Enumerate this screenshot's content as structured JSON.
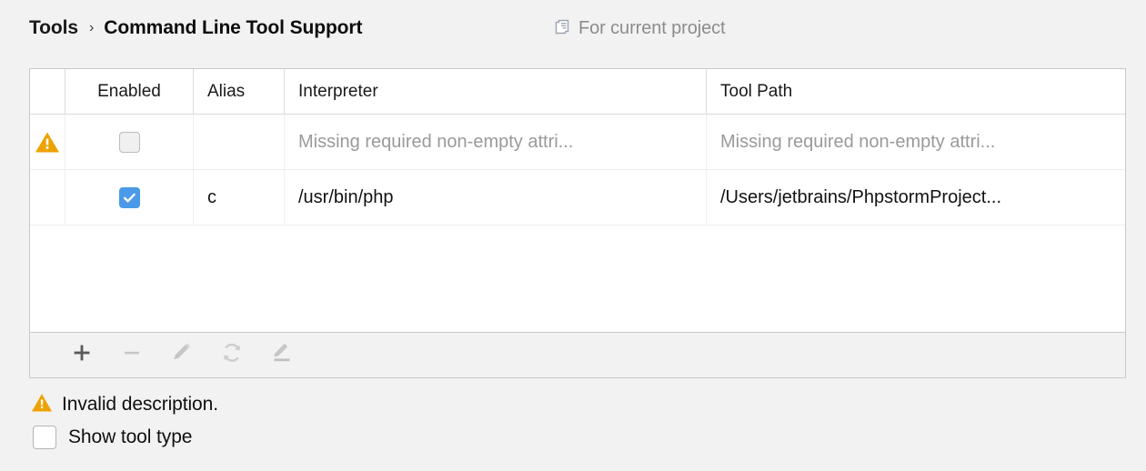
{
  "header": {
    "breadcrumb_parent": "Tools",
    "breadcrumb_separator": "›",
    "breadcrumb_current": "Command Line Tool Support",
    "scope_icon": "copy-project-icon",
    "scope_label": "For current project"
  },
  "table": {
    "columns": [
      {
        "key": "status",
        "label": ""
      },
      {
        "key": "enabled",
        "label": "Enabled"
      },
      {
        "key": "alias",
        "label": "Alias"
      },
      {
        "key": "interpreter",
        "label": "Interpreter"
      },
      {
        "key": "tool_path",
        "label": "Tool Path"
      }
    ],
    "rows": [
      {
        "status_icon": "warning-triangle-icon",
        "enabled": false,
        "alias": "",
        "interpreter": "Missing required non-empty attri...",
        "interpreter_muted": true,
        "tool_path": "Missing required non-empty attri...",
        "tool_path_muted": true
      },
      {
        "status_icon": "",
        "enabled": true,
        "alias": "c",
        "interpreter": "/usr/bin/php",
        "interpreter_muted": false,
        "tool_path": "/Users/jetbrains/PhpstormProject...",
        "tool_path_muted": false
      }
    ]
  },
  "toolbar": {
    "buttons": [
      {
        "name": "add-button",
        "icon": "plus-icon",
        "enabled": true
      },
      {
        "name": "remove-button",
        "icon": "minus-icon",
        "enabled": false
      },
      {
        "name": "edit-button",
        "icon": "pencil-icon",
        "enabled": false
      },
      {
        "name": "refresh-button",
        "icon": "refresh-icon",
        "enabled": false
      },
      {
        "name": "edit-description-button",
        "icon": "pencil-underline-icon",
        "enabled": false
      }
    ]
  },
  "messages": {
    "invalid_icon": "warning-triangle-icon",
    "invalid_text": "Invalid description."
  },
  "options": {
    "show_tool_type_label": "Show tool type",
    "show_tool_type_checked": false
  },
  "colors": {
    "background": "#f2f2f2",
    "table_background": "#ffffff",
    "table_border": "#c9c9c9",
    "warning_amber": "#eda200",
    "checkbox_blue": "#4a9ae8",
    "muted_text": "#9a9a9a",
    "primary_text": "#101010",
    "scope_text": "#8c8c8c",
    "icon_disabled": "#c8c8c8",
    "icon_enabled": "#5a5a5a"
  }
}
